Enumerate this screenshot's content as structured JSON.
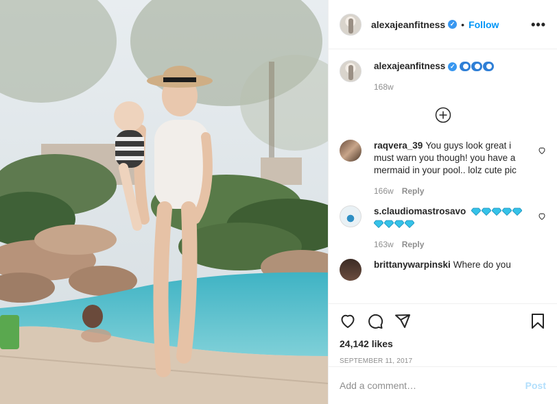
{
  "post": {
    "author": "alexajeanfitness",
    "follow_label": "Follow",
    "more_label": "•••",
    "verified_glyph": "✓"
  },
  "caption": {
    "username": "alexajeanfitness",
    "emoji_count": 3,
    "time": "168w"
  },
  "comments": [
    {
      "username": "raqvera_39",
      "text": "You guys look great i must warn you though! you have a mermaid in your pool.. lolz cute pic",
      "time": "166w",
      "reply_label": "Reply"
    },
    {
      "username": "s.claudiomastrosavo",
      "text": "",
      "gems": 9,
      "time": "163w",
      "reply_label": "Reply"
    },
    {
      "username": "brittanywarpinski",
      "text": "Where do you"
    }
  ],
  "likes": "24,142 likes",
  "date": "September 11, 2017",
  "composer": {
    "placeholder": "Add a comment…",
    "post_label": "Post"
  },
  "icons": [
    "heart-icon",
    "comment-icon",
    "share-icon",
    "bookmark-icon",
    "plus-circle-icon",
    "verified-icon",
    "more-icon"
  ],
  "colors": {
    "link_blue": "#0095f6",
    "verified_blue": "#3897f0",
    "muted": "#8e8e8e",
    "post_disabled": "#b2dffc"
  }
}
